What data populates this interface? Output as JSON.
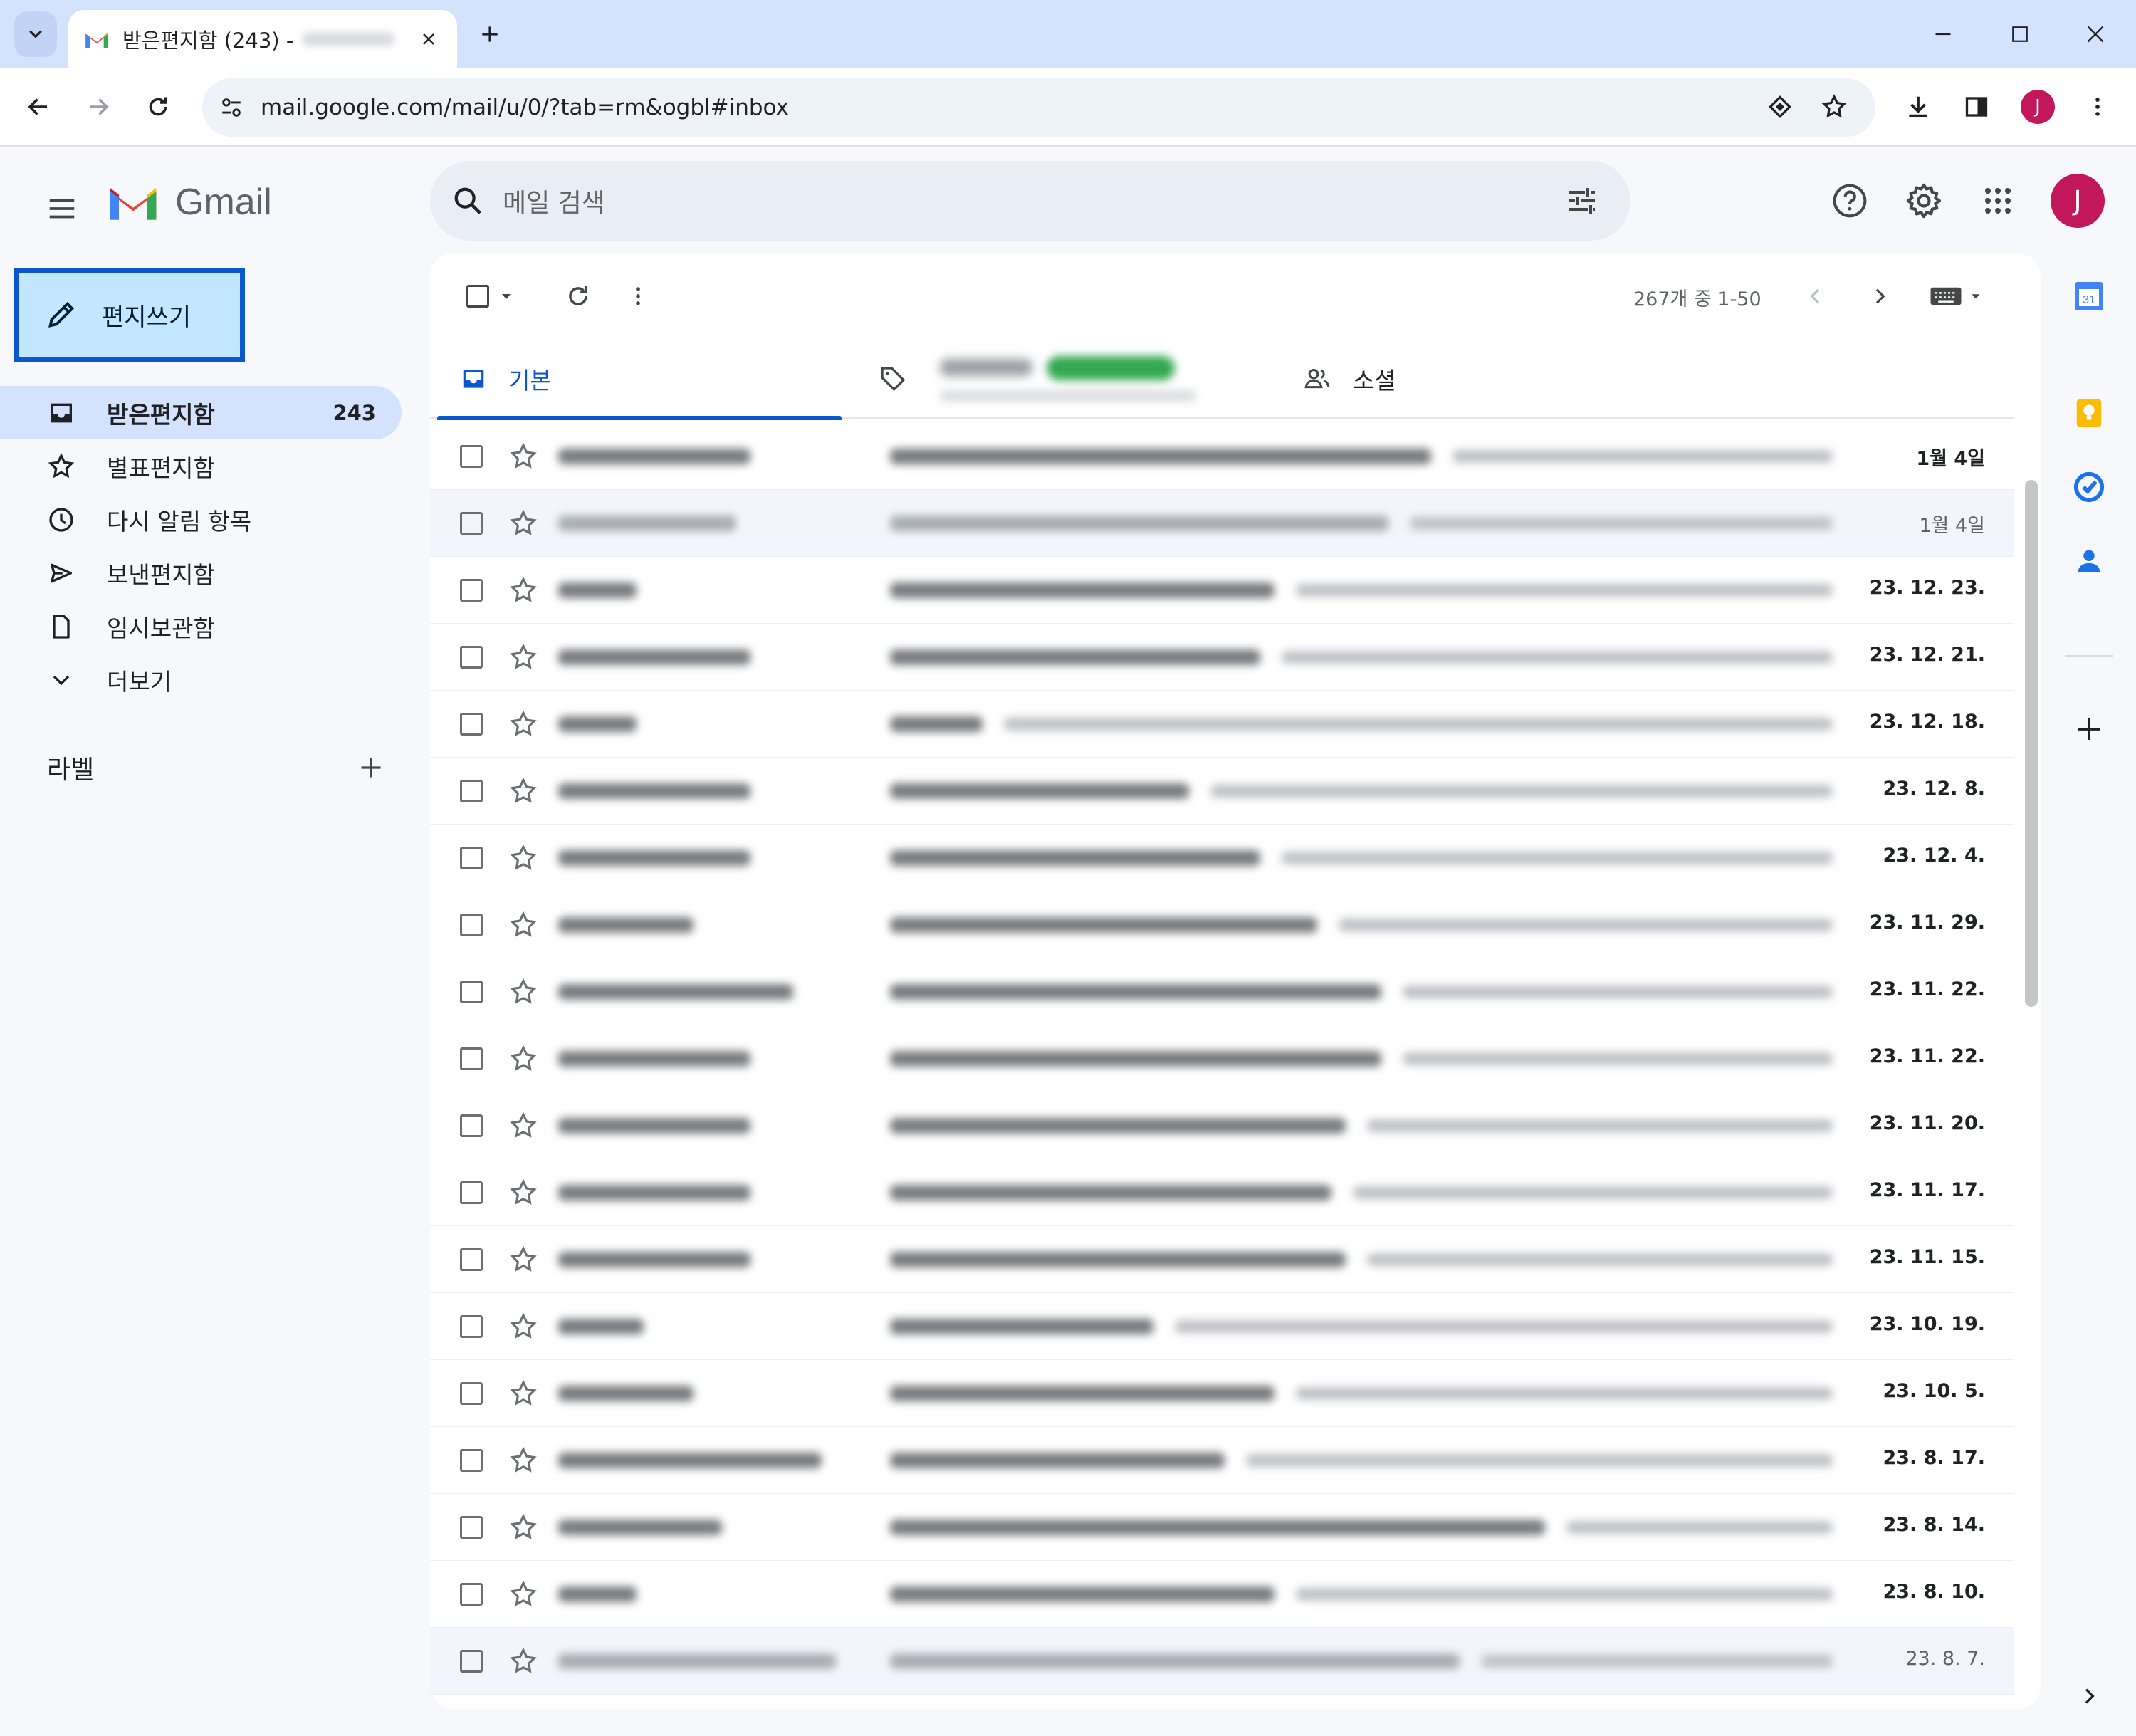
{
  "browser": {
    "tab_title": "받은편지함 (243) -",
    "url": "mail.google.com/mail/u/0/?tab=rm&ogbl#inbox",
    "profile_initial": "J"
  },
  "gmail": {
    "logo_text": "Gmail",
    "search_placeholder": "메일 검색",
    "account_initial": "J",
    "compose_label": "편지쓰기",
    "nav": [
      {
        "label": "받은편지함",
        "count": "243",
        "icon": "inbox-icon"
      },
      {
        "label": "별표편지함",
        "count": "",
        "icon": "star-icon"
      },
      {
        "label": "다시 알림 항목",
        "count": "",
        "icon": "clock-icon"
      },
      {
        "label": "보낸편지함",
        "count": "",
        "icon": "send-icon"
      },
      {
        "label": "임시보관함",
        "count": "",
        "icon": "draft-icon"
      },
      {
        "label": "더보기",
        "count": "",
        "icon": "chevron-down-icon"
      }
    ],
    "labels_title": "라벨",
    "pager": "267개 중 1-50",
    "tabs": {
      "primary": "기본",
      "social": "소셜"
    },
    "emails": [
      {
        "date": "1월 4일",
        "read": false
      },
      {
        "date": "1월 4일",
        "read": true
      },
      {
        "date": "23. 12. 23.",
        "read": false
      },
      {
        "date": "23. 12. 21.",
        "read": false
      },
      {
        "date": "23. 12. 18.",
        "read": false
      },
      {
        "date": "23. 12. 8.",
        "read": false
      },
      {
        "date": "23. 12. 4.",
        "read": false
      },
      {
        "date": "23. 11. 29.",
        "read": false
      },
      {
        "date": "23. 11. 22.",
        "read": false
      },
      {
        "date": "23. 11. 22.",
        "read": false
      },
      {
        "date": "23. 11. 20.",
        "read": false
      },
      {
        "date": "23. 11. 17.",
        "read": false
      },
      {
        "date": "23. 11. 15.",
        "read": false
      },
      {
        "date": "23. 10. 19.",
        "read": false
      },
      {
        "date": "23. 10. 5.",
        "read": false
      },
      {
        "date": "23. 8. 17.",
        "read": false
      },
      {
        "date": "23. 8. 14.",
        "read": false
      },
      {
        "date": "23. 8. 10.",
        "read": false
      },
      {
        "date": "23. 8. 7.",
        "read": true
      }
    ]
  },
  "colors": {
    "accent": "#0b57d0",
    "compose_bg": "#c2e7ff",
    "avatar": "#c2185b"
  }
}
